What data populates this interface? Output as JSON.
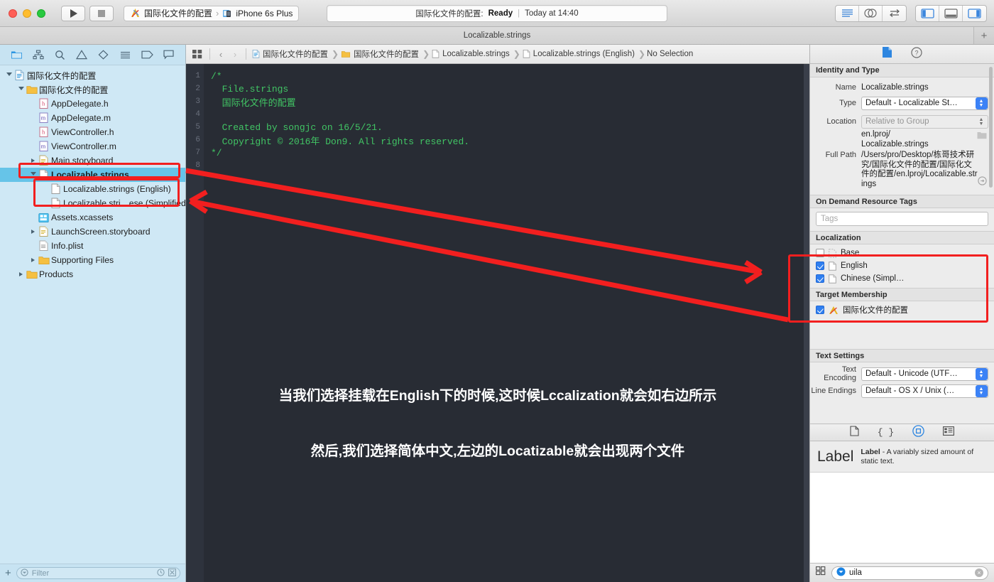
{
  "window": {
    "title": "Localizable.strings",
    "traffic_lights": [
      "close",
      "minimize",
      "zoom"
    ]
  },
  "toolbar": {
    "run_button": "run-button",
    "stop_button": "stop-button",
    "scheme_name": "国际化文件的配置",
    "destination": "iPhone 6s Plus",
    "status_project": "国际化文件的配置:",
    "status_state": "Ready",
    "status_time": "Today at 14:40",
    "right_segment_1": [
      "standard-editor",
      "assistant-editor",
      "version-editor"
    ],
    "right_segment_2": [
      "hide-navigator",
      "hide-debug-area",
      "hide-utilities"
    ]
  },
  "tabbar": {
    "active_tab": "Localizable.strings",
    "add_tab": "+"
  },
  "navigator": {
    "toolbar_icons": [
      "folder-icon",
      "hierarchy-icon",
      "search-icon",
      "warning-icon",
      "breakpoint-icon",
      "test-icon",
      "tag-icon",
      "report-icon"
    ],
    "tree": [
      {
        "label": "国际化文件的配置",
        "indent": 0,
        "icon": "project-icon",
        "twisty": "open",
        "selected": false
      },
      {
        "label": "国际化文件的配置",
        "indent": 1,
        "icon": "folder-icon",
        "twisty": "open",
        "selected": false
      },
      {
        "label": "AppDelegate.h",
        "indent": 2,
        "icon": "header-icon",
        "twisty": "none",
        "selected": false
      },
      {
        "label": "AppDelegate.m",
        "indent": 2,
        "icon": "source-icon",
        "twisty": "none",
        "selected": false
      },
      {
        "label": "ViewController.h",
        "indent": 2,
        "icon": "header-icon",
        "twisty": "none",
        "selected": false
      },
      {
        "label": "ViewController.m",
        "indent": 2,
        "icon": "source-icon",
        "twisty": "none",
        "selected": false
      },
      {
        "label": "Main.storyboard",
        "indent": 2,
        "icon": "storyboard-icon",
        "twisty": "closed",
        "selected": false
      },
      {
        "label": "Localizable.strings",
        "indent": 2,
        "icon": "strings-icon",
        "twisty": "open",
        "selected": true
      },
      {
        "label": "Localizable.strings (English)",
        "indent": 3,
        "icon": "strings-icon",
        "twisty": "none",
        "selected": false
      },
      {
        "label": "Localizable.stri…ese (Simplified)",
        "indent": 3,
        "icon": "strings-icon",
        "twisty": "none",
        "selected": false
      },
      {
        "label": "Assets.xcassets",
        "indent": 2,
        "icon": "assets-icon",
        "twisty": "none",
        "selected": false
      },
      {
        "label": "LaunchScreen.storyboard",
        "indent": 2,
        "icon": "storyboard-icon",
        "twisty": "closed",
        "selected": false
      },
      {
        "label": "Info.plist",
        "indent": 2,
        "icon": "plist-icon",
        "twisty": "none",
        "selected": false
      },
      {
        "label": "Supporting Files",
        "indent": 2,
        "icon": "folder-icon",
        "twisty": "closed",
        "selected": false
      },
      {
        "label": "Products",
        "indent": 1,
        "icon": "folder-icon",
        "twisty": "closed",
        "selected": false
      }
    ],
    "filter_placeholder": "Filter",
    "add_button": "+"
  },
  "jumpbar": {
    "back": "‹",
    "forward": "›",
    "crumbs": [
      {
        "label": "国际化文件的配置",
        "icon": "project-icon"
      },
      {
        "label": "国际化文件的配置",
        "icon": "folder-icon"
      },
      {
        "label": "Localizable.strings",
        "icon": "strings-icon"
      },
      {
        "label": "Localizable.strings (English)",
        "icon": "strings-icon"
      },
      {
        "label": "No Selection",
        "icon": "none"
      }
    ]
  },
  "editor": {
    "lines": [
      {
        "n": "1",
        "text": "/*"
      },
      {
        "n": "2",
        "text": "  File.strings"
      },
      {
        "n": "3",
        "text": "  国际化文件的配置"
      },
      {
        "n": "4",
        "text": ""
      },
      {
        "n": "5",
        "text": "  Created by songjc on 16/5/21."
      },
      {
        "n": "6",
        "text": "  Copyright © 2016年 Don9. All rights reserved."
      },
      {
        "n": "7",
        "text": "*/"
      },
      {
        "n": "8",
        "text": ""
      }
    ],
    "annotation_line_1": "当我们选择挂载在English下的时候,这时候Lccalization就会如右边所示",
    "annotation_line_2": "然后,我们选择简体中文,左边的Locatizable就会出现两个文件",
    "comment_color": "#41c464",
    "background_color": "#282c34"
  },
  "inspector": {
    "tabs": [
      "file-inspector-icon",
      "quick-help-icon"
    ],
    "identity_and_type": {
      "title": "Identity and Type",
      "name_label": "Name",
      "name_value": "Localizable.strings",
      "type_label": "Type",
      "type_value": "Default - Localizable St…",
      "location_label": "Location",
      "location_value": "Relative to Group",
      "relative_path": "en.lproj/\nLocalizable.strings",
      "full_path_label": "Full Path",
      "full_path_value": "/Users/pro/Desktop/栋哥技术研究/国际化文件的配置/国际化文件的配置/en.lproj/Localizable.strings"
    },
    "on_demand_resource_tags": {
      "title": "On Demand Resource Tags",
      "tags_placeholder": "Tags"
    },
    "localization": {
      "title": "Localization",
      "items": [
        {
          "label": "Base",
          "checked": false
        },
        {
          "label": "English",
          "checked": true
        },
        {
          "label": "Chinese (Simpl…",
          "checked": true
        }
      ]
    },
    "target_membership": {
      "title": "Target Membership",
      "items": [
        {
          "label": "国际化文件的配置",
          "checked": true,
          "icon": "target-icon"
        }
      ]
    },
    "text_settings": {
      "title": "Text Settings",
      "text_encoding_label": "Text Encoding",
      "text_encoding_value": "Default - Unicode (UTF…",
      "line_endings_label": "Line Endings",
      "line_endings_value": "Default - OS X / Unix (…"
    }
  },
  "library": {
    "tabs": [
      "file-template-icon",
      "code-snippet-icon",
      "object-library-icon",
      "media-library-icon"
    ],
    "active_tab_index": 2,
    "items": [
      {
        "preview": "Label",
        "name": "Label",
        "description": " - A variably sized amount of static text."
      }
    ],
    "search_value": "uila",
    "search_clear": "×",
    "grid_icon": "grid-icon"
  },
  "annotations": {
    "accent_color": "#f21f1f",
    "boxes": [
      "localizable-strings-row",
      "localized-children-rows",
      "localization-section"
    ],
    "arrows": 2
  }
}
